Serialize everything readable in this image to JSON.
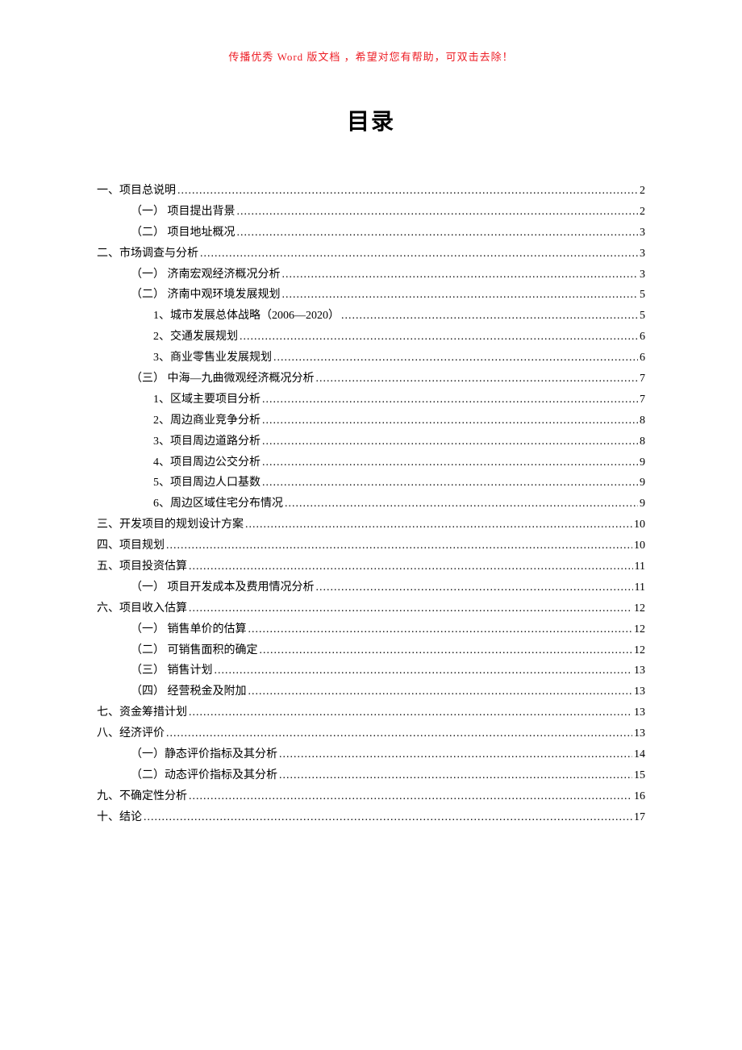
{
  "header_note": "传播优秀 Word 版文档 ，希望对您有帮助，可双击去除！",
  "title": "目录",
  "toc": [
    {
      "level": 0,
      "label": "一、项目总说明",
      "page": "2"
    },
    {
      "level": 1,
      "label": "（一） 项目提出背景",
      "page": "2"
    },
    {
      "level": 1,
      "label": "（二） 项目地址概况",
      "page": "3"
    },
    {
      "level": 0,
      "label": "二、市场调查与分析",
      "page": "3"
    },
    {
      "level": 1,
      "label": "（一） 济南宏观经济概况分析",
      "page": "3"
    },
    {
      "level": 1,
      "label": "（二） 济南中观环境发展规划",
      "page": "5"
    },
    {
      "level": 2,
      "label": "1、城市发展总体战略（2006—2020）",
      "page": "5"
    },
    {
      "level": 2,
      "label": "2、交通发展规划",
      "page": "6"
    },
    {
      "level": 2,
      "label": "3、商业零售业发展规划",
      "page": "6"
    },
    {
      "level": 1,
      "label": "（三） 中海—九曲微观经济概况分析",
      "page": "7"
    },
    {
      "level": 2,
      "label": "1、区域主要项目分析",
      "page": "7"
    },
    {
      "level": 2,
      "label": "2、周边商业竞争分析",
      "page": "8"
    },
    {
      "level": 2,
      "label": "3、项目周边道路分析",
      "page": "8"
    },
    {
      "level": 2,
      "label": "4、项目周边公交分析",
      "page": "9"
    },
    {
      "level": 2,
      "label": "5、项目周边人口基数",
      "page": "9"
    },
    {
      "level": 2,
      "label": "6、周边区域住宅分布情况",
      "page": "9"
    },
    {
      "level": 0,
      "label": "三、开发项目的规划设计方案",
      "page": "10"
    },
    {
      "level": 0,
      "label": "四、项目规划",
      "page": "10"
    },
    {
      "level": 0,
      "label": "五、项目投资估算",
      "page": "11"
    },
    {
      "level": 1,
      "label": "（一） 项目开发成本及费用情况分析",
      "page": "11"
    },
    {
      "level": 0,
      "label": "六、项目收入估算",
      "page": "12"
    },
    {
      "level": 1,
      "label": "（一） 销售单价的估算",
      "page": "12"
    },
    {
      "level": 1,
      "label": "（二） 可销售面积的确定",
      "page": "12"
    },
    {
      "level": 1,
      "label": "（三） 销售计划",
      "page": "13"
    },
    {
      "level": 1,
      "label": "（四） 经营税金及附加",
      "page": "13"
    },
    {
      "level": 0,
      "label": "七、资金筹措计划",
      "page": "13"
    },
    {
      "level": 0,
      "label": "八、经济评价",
      "page": "13"
    },
    {
      "level": 1,
      "label": "（一）静态评价指标及其分析",
      "page": "14"
    },
    {
      "level": 1,
      "label": "（二）动态评价指标及其分析",
      "page": "15"
    },
    {
      "level": 0,
      "label": "九、不确定性分析",
      "page": "16"
    },
    {
      "level": 0,
      "label": "十、结论",
      "page": "17"
    }
  ]
}
